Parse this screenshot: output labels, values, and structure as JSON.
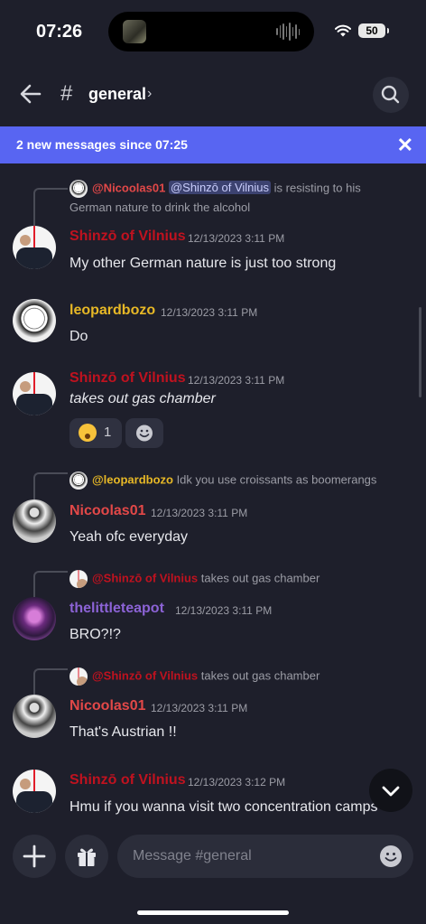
{
  "status_bar": {
    "time": "07:26",
    "battery": "50"
  },
  "header": {
    "hash": "#",
    "channel": "general",
    "chevron": "›"
  },
  "banner": {
    "text": "2 new messages since 07:25",
    "close": "✕"
  },
  "messages": [
    {
      "reply": {
        "name": "@Nicoolas01",
        "mention": "@Shinzō of Vilnius",
        "text": " is resisting to his",
        "text2": "German nature to drink the alcohol"
      },
      "username": "Shinzō of Vilnius",
      "timestamp": "12/13/2023 3:11 PM",
      "body": "My other German nature is just too strong"
    },
    {
      "username": "leopardbozo",
      "timestamp": "12/13/2023 3:11 PM",
      "body": "Do"
    },
    {
      "username": "Shinzō of Vilnius",
      "timestamp": "12/13/2023 3:11 PM",
      "body": "takes out gas chamber",
      "reaction_count": "1"
    },
    {
      "reply": {
        "name": "@leopardbozo",
        "text": " Idk you use croissants as boomerangs"
      },
      "username": "Nicoolas01",
      "timestamp": "12/13/2023 3:11 PM",
      "body": "Yeah ofc everyday"
    },
    {
      "reply": {
        "name": "@Shinzō of Vilnius",
        "text": " takes out gas chamber"
      },
      "username": "thelittleteapot",
      "timestamp": "12/13/2023 3:11 PM",
      "body": "BRO?!?"
    },
    {
      "reply": {
        "name": "@Shinzō of Vilnius",
        "text": " takes out gas chamber"
      },
      "username": "Nicoolas01",
      "timestamp": "12/13/2023 3:11 PM",
      "body": "That's Austrian !!"
    },
    {
      "username": "Shinzō of Vilnius",
      "timestamp": "12/13/2023 3:12 PM",
      "body": "Hmu if you wanna visit two concentration camps"
    }
  ],
  "composer": {
    "placeholder": "Message #general"
  },
  "colors": {
    "accent": "#5865f2",
    "shinzo": "#c0121f",
    "leopardbozo": "#e7b826",
    "nicoolas": "#e24848",
    "teapot": "#8c63d6"
  }
}
